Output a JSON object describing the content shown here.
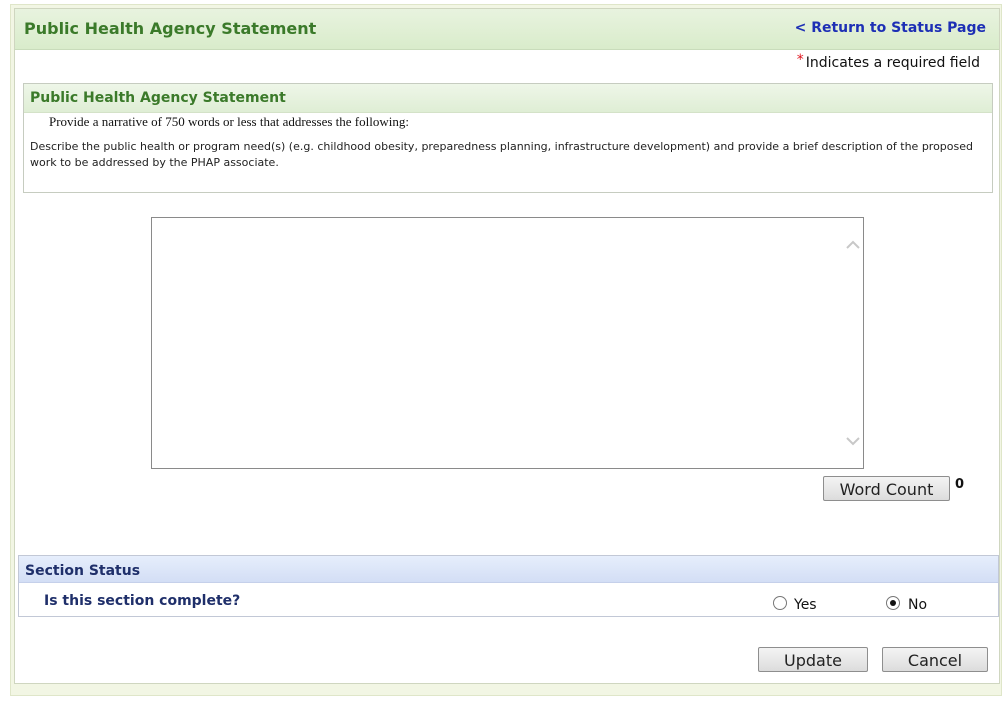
{
  "header": {
    "title": "Public Health Agency Statement",
    "return_link": "< Return to Status Page"
  },
  "required_note": {
    "star": "*",
    "text": "Indicates a required field"
  },
  "statement": {
    "title": "Public Health Agency Statement",
    "prompt": "Provide a narrative of 750 words or less that addresses the following:",
    "description": "Describe the public health or program need(s) (e.g. childhood obesity, preparedness planning, infrastructure development) and provide a brief description of the proposed work to be addressed by the PHAP associate."
  },
  "narrative": {
    "value": ""
  },
  "word_count": {
    "button_label": "Word Count",
    "value": "0"
  },
  "section_status": {
    "title": "Section Status",
    "question": "Is this section complete?",
    "options": [
      {
        "label": "Yes",
        "checked": false
      },
      {
        "label": "No",
        "checked": true
      }
    ]
  },
  "actions": {
    "update_label": "Update",
    "cancel_label": "Cancel"
  },
  "colors": {
    "title_green": "#3b7a2a",
    "link_blue": "#1d2fb5",
    "status_navy": "#1f2f6a",
    "required_red": "#e0141e"
  }
}
